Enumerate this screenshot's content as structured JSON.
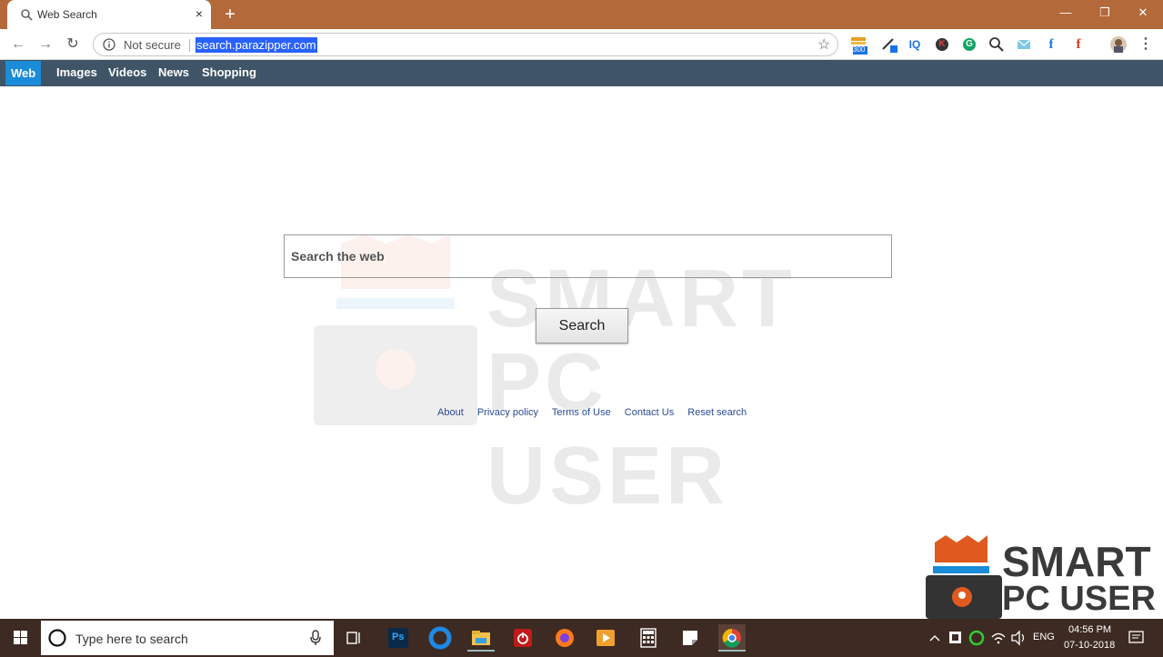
{
  "browser": {
    "tab_title": "Web Search",
    "tab_close": "×",
    "new_tab": "+",
    "security_label": "Not secure",
    "url": "search.parazipper.com",
    "ext_badge": "300",
    "ext_iq": "IQ",
    "ext_k": "K",
    "ext_g": "G",
    "ext_f1": "f",
    "ext_f2": "f"
  },
  "nav": {
    "items": [
      {
        "label": "Web",
        "active": true
      },
      {
        "label": "Images"
      },
      {
        "label": "Videos"
      },
      {
        "label": "News"
      },
      {
        "label": "Shopping"
      }
    ]
  },
  "main": {
    "search_placeholder": "Search the web",
    "search_button": "Search",
    "footer_links": [
      "About",
      "Privacy policy",
      "Terms of Use",
      "Contact Us",
      "Reset search"
    ]
  },
  "watermark": {
    "line1": "SMART",
    "line2": "PC USER"
  },
  "taskbar": {
    "search_placeholder": "Type here to search",
    "language": "ENG",
    "time": "04:56 PM",
    "date": "07-10-2018",
    "ps_label": "Ps"
  },
  "colors": {
    "titlebar": "#b4693a",
    "nav_bar": "#3f5466",
    "nav_active": "#1a8cd8",
    "taskbar": "#3d2a22",
    "url_highlight": "#2962ff"
  }
}
